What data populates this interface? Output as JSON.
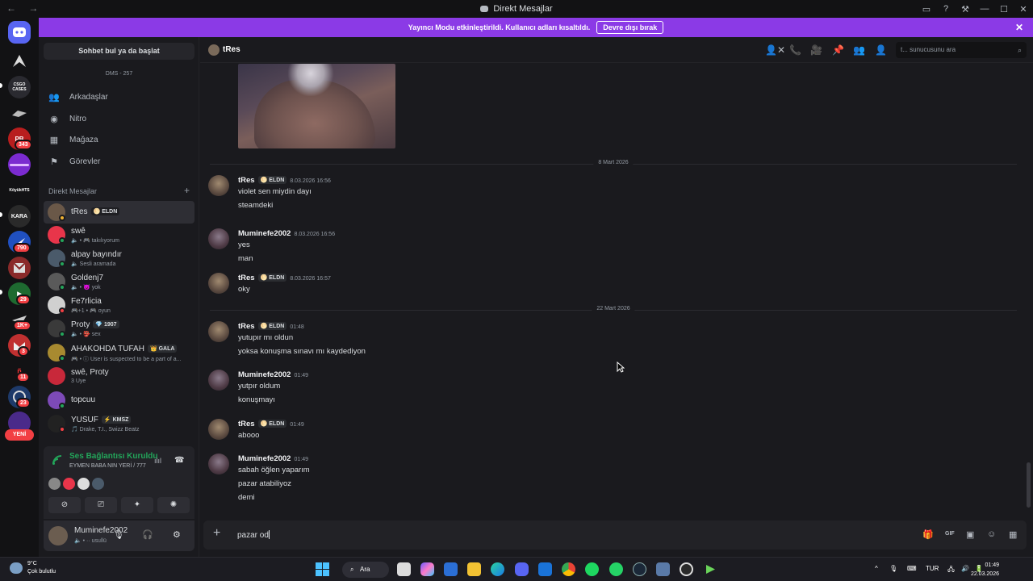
{
  "window": {
    "title": "Direkt Mesajlar",
    "nav_arrows": "← →",
    "controls": [
      "▭",
      "?",
      "⚒",
      "—",
      "☐",
      "✕"
    ]
  },
  "banner": {
    "text": "Yayıncı Modu etkinleştirildi. Kullanıcı adları kısaltıldı.",
    "button": "Devre dışı bırak",
    "close": "✕"
  },
  "servers": {
    "badges": [
      "343",
      "790",
      "29",
      "1K+",
      "3",
      "11",
      "23"
    ],
    "labels": [
      "CSGO CASES",
      "KöyükHTS",
      "KARA"
    ],
    "new_label": "YENİ"
  },
  "sidebar": {
    "find_button": "Sohbet bul ya da başlat",
    "dms_count": "DMS - 257",
    "nav": [
      {
        "label": "Arkadaşlar",
        "icon": "friends-icon",
        "glyph": "👥"
      },
      {
        "label": "Nitro",
        "icon": "nitro-icon",
        "glyph": "◉"
      },
      {
        "label": "Mağaza",
        "icon": "shop-icon",
        "glyph": "▦"
      },
      {
        "label": "Görevler",
        "icon": "quests-icon",
        "glyph": "⚑"
      }
    ],
    "dm_header": "Direkt Mesajlar",
    "dm_header_add": "+",
    "dms": [
      {
        "name": "tRes",
        "tag": "🌕 ELDN",
        "status": "",
        "status_color": "#f0b232",
        "avatar": "#6a5848"
      },
      {
        "name": "swê",
        "tag": "",
        "status": "🔈 • 🎮 takılıyorum",
        "status_color": "#23a55a",
        "avatar": "#e8354a"
      },
      {
        "name": "alpay bayındır",
        "tag": "",
        "status": "🔈 Sesli aramada",
        "status_color": "#23a55a",
        "avatar": "#4a5a6a"
      },
      {
        "name": "Goldenj7",
        "tag": "",
        "status": "🔈 • 😈 yok",
        "status_color": "#23a55a",
        "avatar": "#5a5a5a"
      },
      {
        "name": "Fe7rlicia",
        "tag": "",
        "status": "🎮+1 • 🎮 oyun",
        "status_color": "#f23f43",
        "avatar": "#d0d0d0"
      },
      {
        "name": "Proty",
        "tag": "💎 1907",
        "status": "🔈 • 👺 sex",
        "status_color": "#23a55a",
        "avatar": "#3a3a3a"
      },
      {
        "name": "AHAKOHDA TUFAH",
        "tag": "👑 GALA",
        "status": "🎮 • ⓘ User is suspected to be a part of a...",
        "status_color": "#23a55a",
        "avatar": "#a88a30"
      },
      {
        "name": "swê, Proty",
        "tag": "",
        "status": "3 Üye",
        "status_color": "",
        "avatar": "#c8283a"
      },
      {
        "name": "topcuu",
        "tag": "",
        "status": "",
        "status_color": "#23a55a",
        "avatar": "#7d4ab8"
      },
      {
        "name": "YUSUF",
        "tag": "⚡ KMSZ",
        "status": "🎵 Drake, T.I., Swizz Beatz",
        "status_color": "#f23f43",
        "avatar": "#222222"
      }
    ]
  },
  "voice": {
    "title": "Ses Bağlantısı Kuruldu",
    "subtitle": "EYMEN BABA NIN YERİ / 777",
    "buttons": [
      "⊘",
      "⎚",
      "✦",
      "✺"
    ],
    "wave": "ılıl",
    "hangup": "☎"
  },
  "user": {
    "name": "Muminefe2002",
    "status": "🔈 • ·· usullü",
    "mic": "🎙",
    "headset": "🎧",
    "settings": "⚙"
  },
  "chat": {
    "header_name": "tRes",
    "search_placeholder": "t... sunucusunu ara",
    "search_icon": "⌕",
    "header_icons": [
      "👤✕",
      "📞",
      "🎥",
      "📌",
      "👥",
      "👤"
    ],
    "dividers": [
      "8 Mart 2026",
      "22 Mart 2026"
    ],
    "messages": [
      {
        "author": "tRes",
        "tag": "🌕 ELDN",
        "time": "8.03.2026 16:56",
        "lines": [
          "violet sen miydin dayı",
          "steamdeki"
        ]
      },
      {
        "author": "Muminefe2002",
        "tag": "",
        "time": "8.03.2026 16:56",
        "lines": [
          "yes",
          "man"
        ]
      },
      {
        "author": "tRes",
        "tag": "🌕 ELDN",
        "time": "8.03.2026 16:57",
        "lines": [
          "oky"
        ]
      },
      {
        "author": "tRes",
        "tag": "🌕 ELDN",
        "time": "01:48",
        "lines": [
          "yutupır mı oldun",
          "yoksa konuşma sınavı mı kaydediyon"
        ]
      },
      {
        "author": "Muminefe2002",
        "tag": "",
        "time": "01:49",
        "lines": [
          "yutpır oldum",
          "konuşmayı"
        ]
      },
      {
        "author": "tRes",
        "tag": "🌕 ELDN",
        "time": "01:49",
        "lines": [
          "abooo"
        ]
      },
      {
        "author": "Muminefe2002",
        "tag": "",
        "time": "01:49",
        "lines": [
          "sabah öğlen yaparım",
          "pazar atabiliyoz",
          "demi"
        ]
      }
    ],
    "composer_text": "pazar od",
    "composer_plus": "+",
    "composer_icons": [
      "🎁",
      "GIF",
      "▣",
      "☺",
      "▦"
    ]
  },
  "taskbar": {
    "temp": "9°C",
    "weather": "Çok bulutlu",
    "search": "Ara",
    "lang": "TUR",
    "time": "01:49",
    "date": "22.03.2026",
    "tray": [
      "^",
      "🎙",
      "⌨",
      "🖧",
      "🔊",
      "🔋"
    ]
  }
}
